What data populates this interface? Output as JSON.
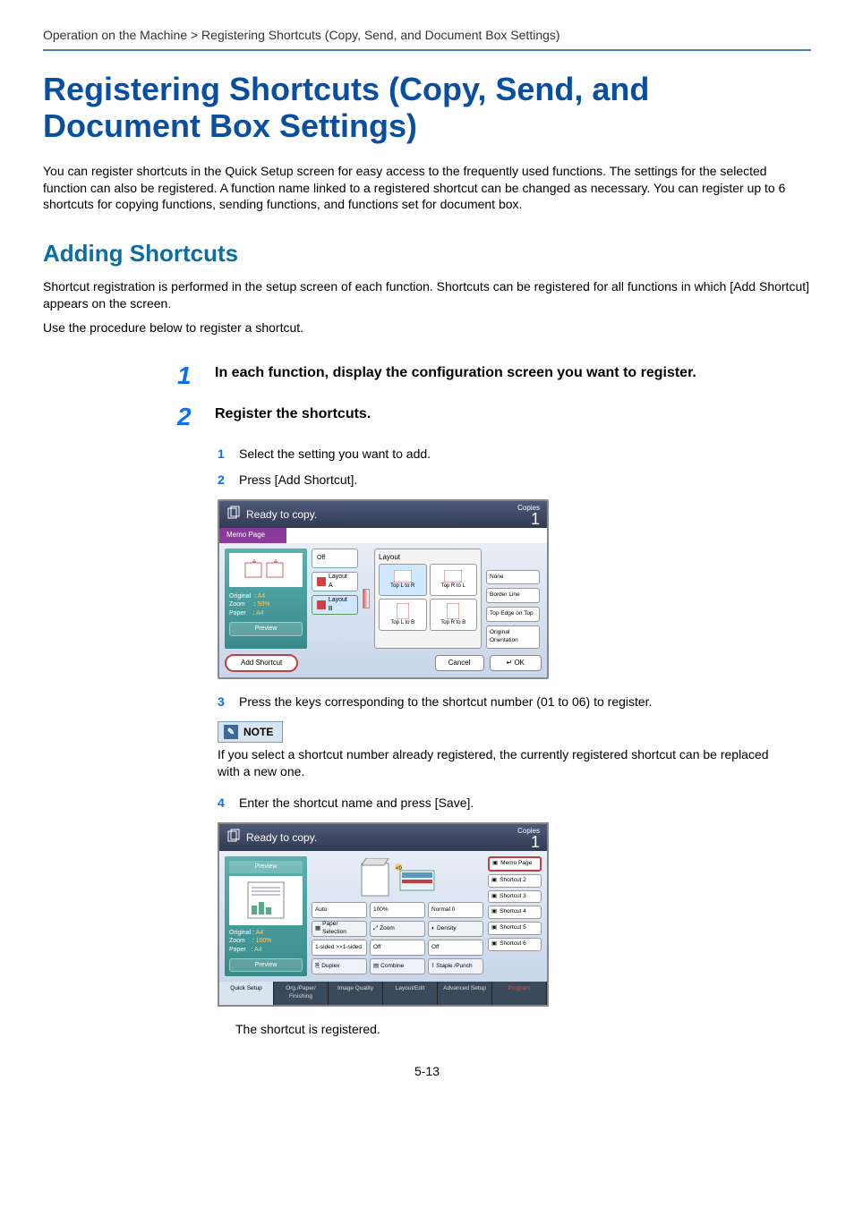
{
  "breadcrumb": "Operation on the Machine > Registering Shortcuts (Copy, Send, and Document Box Settings)",
  "h1": "Registering Shortcuts (Copy, Send, and Document Box Settings)",
  "intro": "You can register shortcuts in the Quick Setup screen for easy access to the frequently used functions. The settings for the selected function can also be registered. A function name linked to a registered shortcut can be changed as necessary. You can register up to 6 shortcuts for copying functions, sending functions, and functions set for document box.",
  "h2": "Adding Shortcuts",
  "sub1": "Shortcut registration is performed in the setup screen of each function. Shortcuts can be registered for all functions in which [Add Shortcut] appears on the screen.",
  "sub2": "Use the procedure below to register a shortcut.",
  "steps": {
    "s1_num": "1",
    "s1_title": "In each function, display the configuration screen you want to register.",
    "s2_num": "2",
    "s2_title": "Register the shortcuts.",
    "s2a_num": "1",
    "s2a_text": "Select the setting you want to add.",
    "s2b_num": "2",
    "s2b_text": "Press [Add Shortcut].",
    "s2c_num": "3",
    "s2c_text": "Press the keys corresponding to the shortcut number (01 to 06) to register.",
    "note_label": "NOTE",
    "note_text": "If you select a shortcut number already registered, the currently registered shortcut can be replaced with a new one.",
    "s2d_num": "4",
    "s2d_text": "Enter the shortcut name and press [Save].",
    "closing": "The shortcut is registered."
  },
  "screen1": {
    "header": "Ready to copy.",
    "copies_label": "Copies",
    "copies_n": "1",
    "tab": "Memo Page",
    "opts_off": "Off",
    "opts_la": "Layout A",
    "opts_lb": "Layout B",
    "layout_label": "Layout",
    "top_ltor": "Top L to R",
    "top_rtol": "Top R to L",
    "top_ltob": "Top L to B",
    "top_rtob": "Top R to B",
    "none": "None",
    "border": "Border Line",
    "topedge": "Top Edge on Top",
    "orient": "Original Orientation",
    "original": "Original",
    "zoom": "Zoom",
    "paper": "Paper",
    "vals_a4": "A4",
    "vals_50": "50%",
    "preview": "Preview",
    "add_shortcut": "Add Shortcut",
    "cancel": "Cancel",
    "ok": "OK"
  },
  "screen2": {
    "header": "Ready to copy.",
    "copies_label": "Copies",
    "copies_n": "1",
    "preview": "Preview",
    "original": "Original",
    "zoom": "Zoom",
    "paper": "Paper",
    "vals_a4": "A4",
    "vals_100": "100%",
    "auto": "Auto",
    "p100": "100%",
    "normal0": "Normal 0",
    "papersel": "Paper Selection",
    "zoom_btn": "Zoom",
    "density": "Density",
    "oneside": "1-sided >>1-sided",
    "off1": "Off",
    "off2": "Off",
    "duplex": "Duplex",
    "combine": "Combine",
    "staple": "Staple /Punch",
    "side": {
      "s1": "Memo Page",
      "s2": "Shortcut 2",
      "s3": "Shortcut 3",
      "s4": "Shortcut 4",
      "s5": "Shortcut 5",
      "s6": "Shortcut 6"
    },
    "tabs": {
      "t1": "Quick Setup",
      "t2": "Org./Paper/ Finishing",
      "t3": "Image Quality",
      "t4": "Layout/Edit",
      "t5": "Advanced Setup",
      "t6": "Program"
    }
  },
  "page_num": "5-13"
}
